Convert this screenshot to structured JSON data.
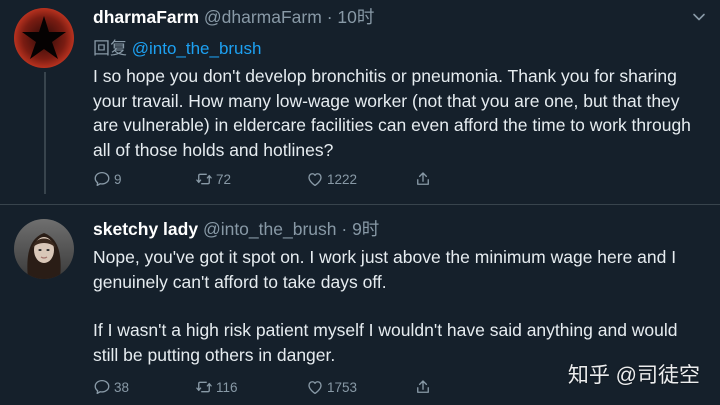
{
  "tweets": [
    {
      "name": "dharmaFarm",
      "handle": "@dharmaFarm",
      "separator": "·",
      "time": "10时",
      "reply_prefix": "回复",
      "reply_mention": "@into_the_brush",
      "body": [
        "I so hope you don't develop bronchitis or pneumonia.  Thank you for sharing your travail.  How many low-wage worker (not that you are one, but that they are vulnerable) in eldercare facilities can even afford the time to work through all of those holds and hotlines?"
      ],
      "replies": "9",
      "retweets": "72",
      "likes": "1222"
    },
    {
      "name": "sketchy lady",
      "handle": "@into_the_brush",
      "separator": "·",
      "time": "9时",
      "body": [
        "Nope, you've got it spot on. I work just above the minimum wage here and I genuinely can't afford to take days off.",
        "If I wasn't a high risk patient myself I wouldn't have said anything and would still be putting others in danger."
      ],
      "replies": "38",
      "retweets": "116",
      "likes": "1753"
    }
  ],
  "watermark": "知乎 @司徒空",
  "icons": {
    "reply": "reply-icon",
    "retweet": "retweet-icon",
    "like": "heart-icon",
    "share": "share-icon",
    "more": "chevron-down-icon"
  },
  "colors": {
    "background": "#15202b",
    "text": "#e6ecf0",
    "muted": "#8899a6",
    "link": "#1da1f2",
    "divider": "#38444d"
  }
}
